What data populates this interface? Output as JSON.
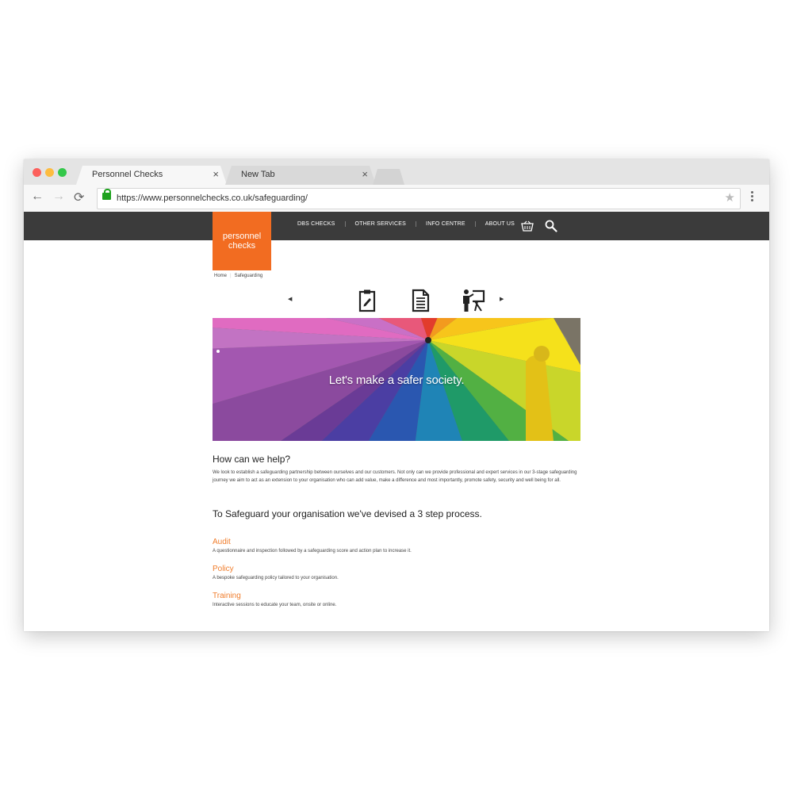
{
  "browser": {
    "tabs": [
      {
        "title": "Personnel Checks",
        "close": "×"
      },
      {
        "title": "New Tab",
        "close": "×"
      }
    ],
    "url": "https://www.personnelchecks.co.uk/safeguarding/",
    "back": "←",
    "forward": "→",
    "reload": "⟳",
    "star": "★"
  },
  "site": {
    "logo": {
      "line1": "personnel",
      "line2": "checks"
    },
    "nav": [
      "DBS CHECKS",
      "OTHER SERVICES",
      "INFO CENTRE",
      "ABOUT US"
    ],
    "breadcrumb": {
      "home": "Home",
      "current": "Safeguarding"
    },
    "carousel": {
      "left_arrow": "◀",
      "right_arrow": "▶",
      "icons": [
        "clipboard-icon",
        "document-icon",
        "presentation-icon"
      ]
    },
    "hero": {
      "tagline": "Let's make a safer society."
    },
    "help": {
      "heading": "How can we help?",
      "body": "We look to establish a safeguarding partnership between ourselves and our customers. Not only can we provide professional and expert services in our 3-stage safeguarding journey we aim to act as an extension to your organisation who can add value, make a difference and most importantly, promote safety, security and well being for all."
    },
    "process_heading": "To Safeguard your organisation we've devised a 3 step process.",
    "steps": [
      {
        "title": "Audit",
        "desc": "A questionnaire and inspection followed by a safeguarding score and action plan to increase it."
      },
      {
        "title": "Policy",
        "desc": "A bespoke safeguarding policy tailored to your organisation."
      },
      {
        "title": "Training",
        "desc": "Interactive sessions to educate your team, onsite or online."
      }
    ],
    "colors": {
      "accent": "#f26c21",
      "nav_bg": "#3b3b3b"
    }
  }
}
